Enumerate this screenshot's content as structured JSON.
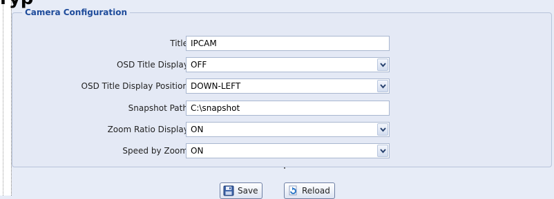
{
  "page": {
    "heading_fragment": "ryp"
  },
  "config": {
    "legend": "Camera Configuration",
    "fields": [
      {
        "label": "Title:",
        "value": "IPCAM",
        "kind": "text"
      },
      {
        "label": "OSD Title Display:",
        "value": "OFF",
        "kind": "select"
      },
      {
        "label": "OSD Title Display Position:",
        "value": "DOWN-LEFT",
        "kind": "select"
      },
      {
        "label": "Snapshot Path:",
        "value": "C:\\snapshot",
        "kind": "text"
      },
      {
        "label": "Zoom Ratio Display:",
        "value": "ON",
        "kind": "select"
      },
      {
        "label": "Speed by Zoom:",
        "value": "ON",
        "kind": "select"
      }
    ]
  },
  "buttons": {
    "save_label": "Save",
    "reload_label": "Reload"
  },
  "icons": {
    "save": "floppy-disk-icon",
    "reload": "reload-icon",
    "dropdown": "chevron-down-icon"
  },
  "colors": {
    "legend": "#1f4c9b",
    "panel": "#e4e9f5",
    "background": "#e7ecf7"
  }
}
